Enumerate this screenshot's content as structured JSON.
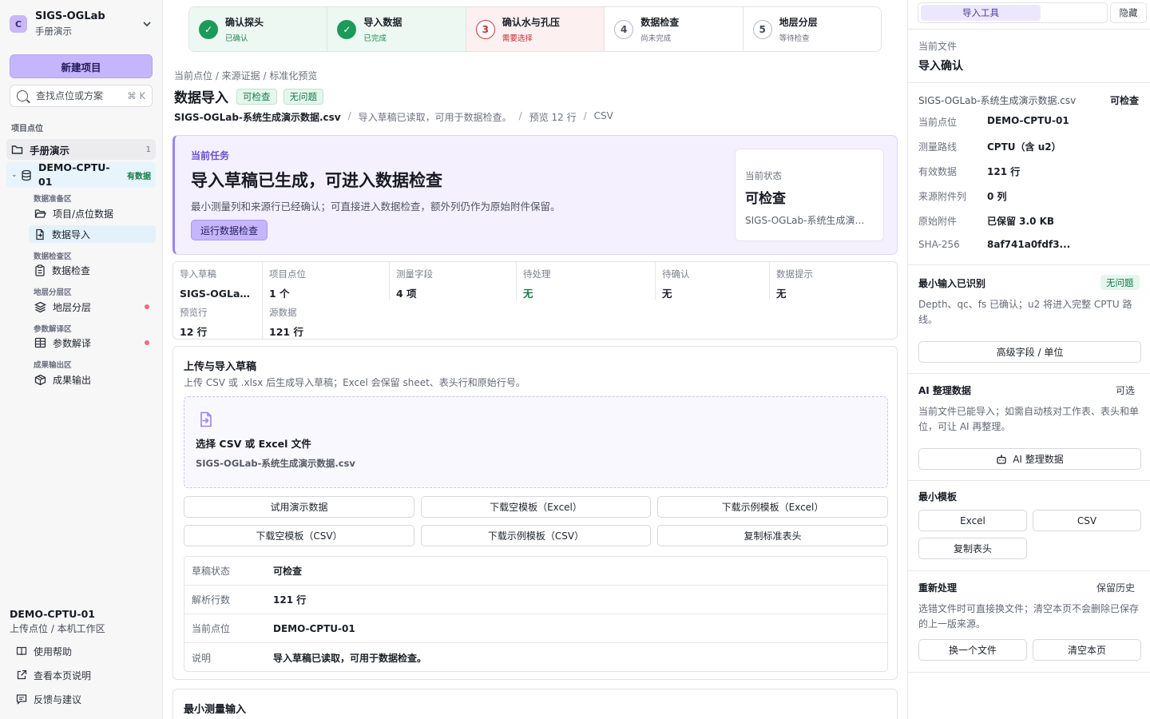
{
  "sidebar": {
    "brand_letter": "C",
    "brand_name": "SIGS-OGLab",
    "brand_sub": "手册演示",
    "new_project": "新建项目",
    "search_placeholder": "查找点位或方案",
    "search_shortcut": "⌘ K",
    "section_label": "项目点位",
    "project": {
      "label": "手册演示",
      "count": "1"
    },
    "point": {
      "label": "DEMO-CPTU-01",
      "badge": "有数据"
    },
    "groups": [
      {
        "title": "数据准备区",
        "items": [
          {
            "label": "项目/点位数据"
          },
          {
            "label": "数据导入"
          }
        ]
      },
      {
        "title": "数据检查区",
        "items": [
          {
            "label": "数据检查"
          }
        ]
      },
      {
        "title": "地层分层区",
        "items": [
          {
            "label": "地层分层"
          }
        ]
      },
      {
        "title": "参数解译区",
        "items": [
          {
            "label": "参数解译"
          }
        ]
      },
      {
        "title": "成果输出区",
        "items": [
          {
            "label": "成果输出"
          }
        ]
      }
    ],
    "footer_title": "DEMO-CPTU-01",
    "footer_sub": "上传点位 / 本机工作区",
    "links": [
      "使用帮助",
      "查看本页说明",
      "反馈与建议"
    ]
  },
  "stepper": [
    {
      "num": "✓",
      "title": "确认探头",
      "status": "已确认",
      "state": "done"
    },
    {
      "num": "✓",
      "title": "导入数据",
      "status": "已完成",
      "state": "done"
    },
    {
      "num": "3",
      "title": "确认水与孔压",
      "status": "需要选择",
      "state": "warn"
    },
    {
      "num": "4",
      "title": "数据检查",
      "status": "尚未完成",
      "state": "todo"
    },
    {
      "num": "5",
      "title": "地层分层",
      "status": "等待检查",
      "state": "todo"
    }
  ],
  "main": {
    "breadcrumb": "当前点位 / 来源证据 / 标准化预览",
    "title": "数据导入",
    "tags": [
      "可检查",
      "无问题"
    ],
    "meta": {
      "file": "SIGS-OGLab-系统生成演示数据.csv",
      "note": "导入草稿已读取，可用于数据检查。",
      "preview": "预览 12 行",
      "format": "CSV"
    },
    "task": {
      "kicker": "当前任务",
      "heading": "导入草稿已生成，可进入数据检查",
      "desc": "最小测量列和来源行已经确认；可直接进入数据检查，额外列仍作为原始附件保留。",
      "button": "运行数据检查",
      "state_label": "当前状态",
      "state_value": "可检查",
      "state_file": "SIGS-OGLab-系统生成演示数据.csv"
    },
    "summary": [
      {
        "label": "导入草稿",
        "value": "SIGS-OGLab-系统生成演示数据.csv"
      },
      {
        "label": "项目点位",
        "value": "1 个"
      },
      {
        "label": "测量字段",
        "value": "4 项"
      },
      {
        "label": "待处理",
        "value": "无",
        "green": true
      },
      {
        "label": "待确认",
        "value": "无"
      },
      {
        "label": "数据提示",
        "value": "无"
      },
      {
        "label": "预览行",
        "value": "12 行"
      },
      {
        "label": "源数据",
        "value": "121 行"
      }
    ],
    "upload": {
      "title": "上传与导入草稿",
      "hint": "上传 CSV 或 .xlsx 后生成导入草稿；Excel 会保留 sheet、表头行和原始行号。",
      "drop_title": "选择 CSV 或 Excel 文件",
      "drop_file": "SIGS-OGLab-系统生成演示数据.csv",
      "buttons": [
        "试用演示数据",
        "下载空模板（Excel）",
        "下载示例模板（Excel）",
        "下载空模板（CSV）",
        "下载示例模板（CSV）",
        "复制标准表头"
      ],
      "rows": [
        {
          "k": "草稿状态",
          "v": "可检查"
        },
        {
          "k": "解析行数",
          "v": "121 行"
        },
        {
          "k": "当前点位",
          "v": "DEMO-CPTU-01"
        },
        {
          "k": "说明",
          "v": "导入草稿已读取，可用于数据检查。"
        }
      ]
    },
    "min_input_title": "最小测量输入"
  },
  "right": {
    "tab": "导入工具",
    "hide": "隐藏",
    "current_file_label": "当前文件",
    "current_file_title": "导入确认",
    "file_name": "SIGS-OGLab-系统生成演示数据.csv",
    "file_state": "可检查",
    "props": [
      {
        "k": "当前点位",
        "v": "DEMO-CPTU-01"
      },
      {
        "k": "测量路线",
        "v": "CPTU（含 u2）"
      },
      {
        "k": "有效数据",
        "v": "121 行"
      },
      {
        "k": "来源附件列",
        "v": "0 列"
      },
      {
        "k": "原始附件",
        "v": "已保留 3.0 KB"
      },
      {
        "k": "SHA-256",
        "v": "8af741a0fdf3..."
      }
    ],
    "min_title": "最小输入已识别",
    "min_tag": "无问题",
    "min_desc": "Depth、qc、fs 已确认；u2 将进入完整 CPTU 路线。",
    "min_btn": "高级字段 / 单位",
    "ai_title": "AI 整理数据",
    "ai_opt": "可选",
    "ai_desc": "当前文件已能导入；如需自动核对工作表、表头和单位，可让 AI 再整理。",
    "ai_btn": "AI 整理数据",
    "tpl_title": "最小模板",
    "tpl_btns": [
      "Excel",
      "CSV",
      "复制表头"
    ],
    "re_title": "重新处理",
    "re_opt": "保留历史",
    "re_desc": "选错文件时可直接换文件；清空本页不会删除已保存的上一版来源。",
    "re_btns": [
      "换一个文件",
      "清空本页"
    ]
  }
}
